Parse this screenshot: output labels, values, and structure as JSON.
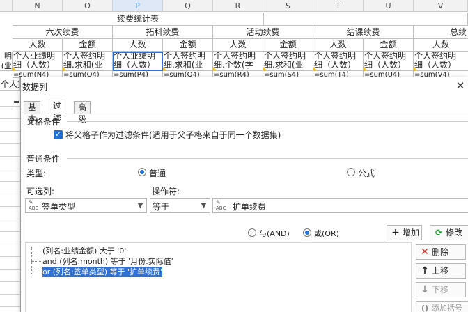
{
  "sheet": {
    "columns": [
      "N",
      "O",
      "P",
      "Q",
      "R",
      "S",
      "T",
      "U",
      "V"
    ],
    "selected_column": "P",
    "title": "续费统计表",
    "groups": [
      "六次续费",
      "拓科续费",
      "活动续费",
      "结课续费",
      "总续"
    ],
    "subheaders": [
      "人数",
      "金额",
      "人数",
      "金额",
      "人数",
      "金额",
      "人数",
      "金额",
      "人数"
    ],
    "row3": [
      "个人业绩明",
      "个人签约明",
      "个人业绩明",
      "个人签约明",
      "个人签约明",
      "个人签约明",
      "个人签约明",
      "个人签约明",
      "个人签约明"
    ],
    "row4": [
      "细（人数）",
      "细.求和(业",
      "细（人数）",
      "细.求和(业",
      "细.个数(学",
      "细.求和(业",
      "细（人数）",
      "细（人数）",
      "细（人数）"
    ],
    "row5": [
      "=sum(N4)",
      "=sum(O4)",
      "=sum(P4)",
      "=sum(Q4)",
      "=sum(R4)",
      "=sum(S4)",
      "=sum(T4)",
      "=sum(U4)",
      "=sum(V4)"
    ],
    "left_col": [
      "明",
      "(业",
      "个人签约",
      "="
    ]
  },
  "dialog": {
    "title": "数据列",
    "tabs": [
      "基本",
      "过滤",
      "高级"
    ],
    "active_tab": "过滤",
    "parent_section": "父格条件",
    "parent_checkbox_label": "将父格子作为过滤条件(适用于父子格来自于同一个数据集)",
    "normal_section": "普通条件",
    "type_label": "类型:",
    "type_options": [
      "普通",
      "公式"
    ],
    "selected_type": "普通",
    "column_label": "可选列:",
    "operator_label": "操作符:",
    "column_value": "签单类型",
    "operator_value": "等于",
    "value_text": "扩单续费",
    "logic_and": "与(AND)",
    "logic_or": "或(OR)",
    "selected_logic": "或(OR)",
    "add_button": "增加",
    "modify_button": "修改",
    "delete_button": "删除",
    "up_button": "上移",
    "down_button": "下移",
    "add_bracket_button": "添加括号",
    "conditions": [
      "(列名:业绩金额) 大于 '0'",
      "and (列名:month) 等于 '月份.实际值'",
      "or (列名:签单类型) 等于 '扩单续费'"
    ],
    "selected_condition": 2,
    "colors": {
      "accent": "#2f6fd8",
      "delete": "#e0281c",
      "add_green": "#2a9d3a"
    }
  }
}
